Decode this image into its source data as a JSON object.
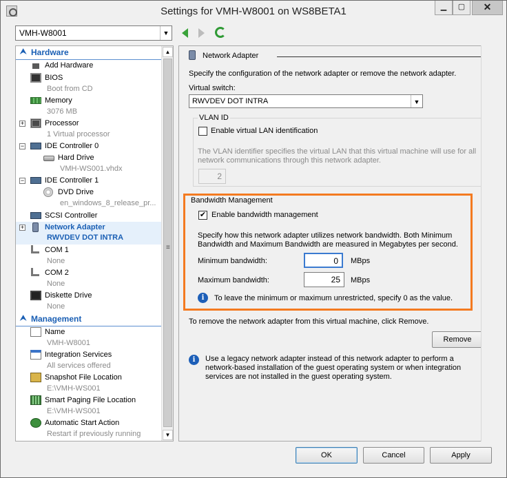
{
  "window": {
    "title": "Settings for VMH-W8001 on WS8BETA1",
    "min_label": "▁",
    "max_label": "▢",
    "close_label": "✕"
  },
  "vm_selector": {
    "value": "VMH-W8001",
    "arrow": "▼"
  },
  "tree": {
    "hardware_header": "Hardware",
    "management_header": "Management",
    "hardware": [
      {
        "label": "Add Hardware",
        "sub": "",
        "icon": "add-hardware-icon"
      },
      {
        "label": "BIOS",
        "sub": "Boot from CD",
        "icon": "bios-icon"
      },
      {
        "label": "Memory",
        "sub": "3076 MB",
        "icon": "memory-icon"
      },
      {
        "label": "Processor",
        "sub": "1 Virtual processor",
        "icon": "processor-icon",
        "expander": "+"
      },
      {
        "label": "IDE Controller 0",
        "sub": "",
        "icon": "ide-controller-icon",
        "expander": "−"
      },
      {
        "label": "Hard Drive",
        "sub": "VMH-WS001.vhdx",
        "icon": "hard-drive-icon"
      },
      {
        "label": "IDE Controller 1",
        "sub": "",
        "icon": "ide-controller-icon",
        "expander": "−"
      },
      {
        "label": "DVD Drive",
        "sub": "en_windows_8_release_pr...",
        "icon": "dvd-drive-icon"
      },
      {
        "label": "SCSI Controller",
        "sub": "",
        "icon": "scsi-controller-icon"
      },
      {
        "label": "Network Adapter",
        "sub": "RWVDEV DOT INTRA",
        "icon": "network-adapter-icon",
        "expander": "+",
        "selected": true
      },
      {
        "label": "COM 1",
        "sub": "None",
        "icon": "com-port-icon"
      },
      {
        "label": "COM 2",
        "sub": "None",
        "icon": "com-port-icon"
      },
      {
        "label": "Diskette Drive",
        "sub": "None",
        "icon": "diskette-drive-icon"
      }
    ],
    "management": [
      {
        "label": "Name",
        "sub": "VMH-W8001",
        "icon": "name-icon"
      },
      {
        "label": "Integration Services",
        "sub": "All services offered",
        "icon": "integration-services-icon"
      },
      {
        "label": "Snapshot File Location",
        "sub": "E:\\VMH-WS001",
        "icon": "snapshot-location-icon"
      },
      {
        "label": "Smart Paging File Location",
        "sub": "E:\\VMH-WS001",
        "icon": "smart-paging-icon"
      },
      {
        "label": "Automatic Start Action",
        "sub": "Restart if previously running",
        "icon": "automatic-start-icon"
      },
      {
        "label": "",
        "sub": "",
        "icon": "automatic-stop-icon"
      }
    ]
  },
  "panel": {
    "heading": "Network Adapter",
    "description": "Specify the configuration of the network adapter or remove the network adapter.",
    "virtual_switch_label": "Virtual switch:",
    "virtual_switch_value": "RWVDEV DOT INTRA",
    "vlan": {
      "legend": "VLAN ID",
      "checkbox_label": "Enable virtual LAN identification",
      "checked": false,
      "help_line1": "The VLAN identifier specifies the virtual LAN that this virtual machine will use for all",
      "help_line2": "network communications through this network adapter.",
      "value": "2"
    },
    "bandwidth": {
      "legend": "Bandwidth Management",
      "checkbox_label": "Enable bandwidth management",
      "checked": true,
      "check_glyph": "✔",
      "desc_line1": "Specify how this network adapter utilizes network bandwidth. Both Minimum",
      "desc_line2": "Bandwidth and Maximum Bandwidth are measured in Megabytes per second.",
      "min_label": "Minimum bandwidth:",
      "min_value": "0",
      "min_unit": "MBps",
      "max_label": "Maximum bandwidth:",
      "max_value": "25",
      "max_unit": "MBps",
      "info": "To leave the minimum or maximum unrestricted, specify 0 as the value."
    },
    "remove_text": "To remove the network adapter from this virtual machine, click Remove.",
    "remove_button": "Remove",
    "legacy_line1": "Use a legacy network adapter instead of this network adapter to perform a",
    "legacy_line2": "network-based installation of the guest operating system or when integration",
    "legacy_line3": "services are not installed in the guest operating system."
  },
  "footer": {
    "ok": "OK",
    "cancel": "Cancel",
    "apply": "Apply"
  },
  "colors": {
    "accent": "#1a5fb4",
    "highlight": "#f47a20",
    "selected_bg": "#e5f0fb"
  }
}
